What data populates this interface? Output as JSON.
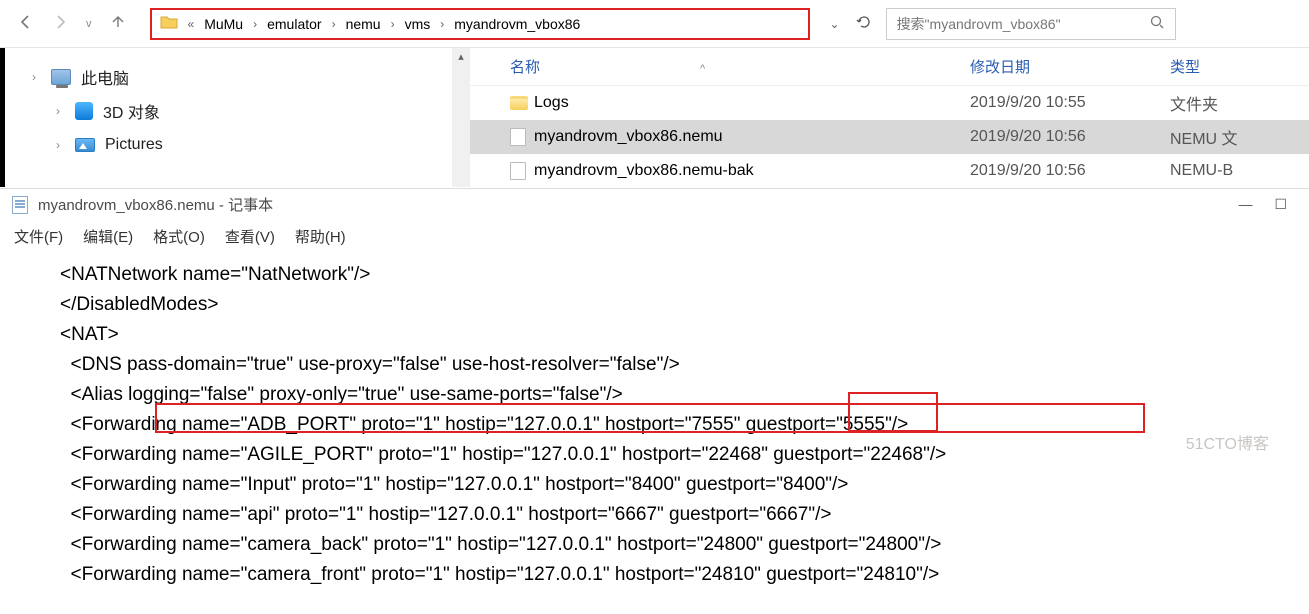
{
  "explorer": {
    "breadcrumb_prefix": "«",
    "crumbs": [
      "MuMu",
      "emulator",
      "nemu",
      "vms",
      "myandrovm_vbox86"
    ],
    "search_placeholder": "搜索\"myandrovm_vbox86\"",
    "tree": {
      "this_pc": "此电脑",
      "objects_3d": "3D 对象",
      "pictures": "Pictures"
    },
    "headers": {
      "name": "名称",
      "date": "修改日期",
      "type": "类型",
      "sort_indicator": "^"
    },
    "rows": [
      {
        "name": "Logs",
        "date": "2019/9/20 10:55",
        "type": "文件夹",
        "icon": "folder",
        "selected": false
      },
      {
        "name": "myandrovm_vbox86.nemu",
        "date": "2019/9/20 10:56",
        "type": "NEMU 文",
        "icon": "file",
        "selected": true
      },
      {
        "name": "myandrovm_vbox86.nemu-bak",
        "date": "2019/9/20 10:56",
        "type": "NEMU-B",
        "icon": "file",
        "selected": false
      }
    ]
  },
  "notepad": {
    "title": "myandrovm_vbox86.nemu - 记事本",
    "menu": {
      "file": "文件(F)",
      "edit": "编辑(E)",
      "format": "格式(O)",
      "view": "查看(V)",
      "help": "帮助(H)"
    },
    "lines": [
      "<NATNetwork name=\"NatNetwork\"/>",
      "</DisabledModes>",
      "<NAT>",
      "  <DNS pass-domain=\"true\" use-proxy=\"false\" use-host-resolver=\"false\"/>",
      "  <Alias logging=\"false\" proxy-only=\"true\" use-same-ports=\"false\"/>",
      "  <Forwarding name=\"ADB_PORT\" proto=\"1\" hostip=\"127.0.0.1\" hostport=\"7555\" guestport=\"5555\"/>",
      "  <Forwarding name=\"AGILE_PORT\" proto=\"1\" hostip=\"127.0.0.1\" hostport=\"22468\" guestport=\"22468\"/>",
      "  <Forwarding name=\"Input\" proto=\"1\" hostip=\"127.0.0.1\" hostport=\"8400\" guestport=\"8400\"/>",
      "  <Forwarding name=\"api\" proto=\"1\" hostip=\"127.0.0.1\" hostport=\"6667\" guestport=\"6667\"/>",
      "  <Forwarding name=\"camera_back\" proto=\"1\" hostip=\"127.0.0.1\" hostport=\"24800\" guestport=\"24800\"/>",
      "  <Forwarding name=\"camera_front\" proto=\"1\" hostip=\"127.0.0.1\" hostport=\"24810\" guestport=\"24810\"/>"
    ]
  },
  "watermark": "51CTO博客"
}
